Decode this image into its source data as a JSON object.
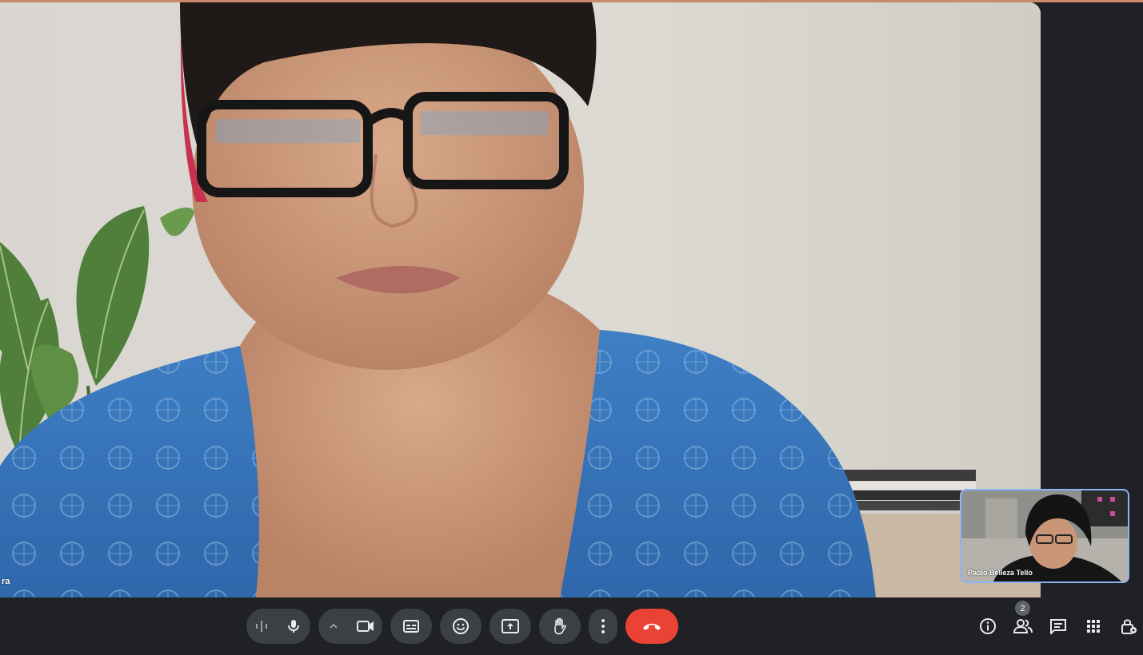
{
  "meeting": {
    "main_participant_name": "ra",
    "self_participant_name": "Paolo Belleza Tello",
    "participant_count": "2"
  },
  "colors": {
    "bar_background": "#202124",
    "button_background": "#3c4043",
    "end_call": "#ea4335",
    "self_tile_border": "#8ab4f8",
    "icon": "#e8eaed"
  },
  "controls": [
    "audio-levels-icon",
    "mic-icon",
    "chevron-up-icon",
    "camera-icon",
    "captions-icon",
    "emoji-icon",
    "present-icon",
    "raise-hand-icon",
    "more-options-icon",
    "end-call-icon"
  ],
  "right_controls": [
    "info-icon",
    "people-icon",
    "chat-icon",
    "activities-icon",
    "host-controls-icon"
  ]
}
